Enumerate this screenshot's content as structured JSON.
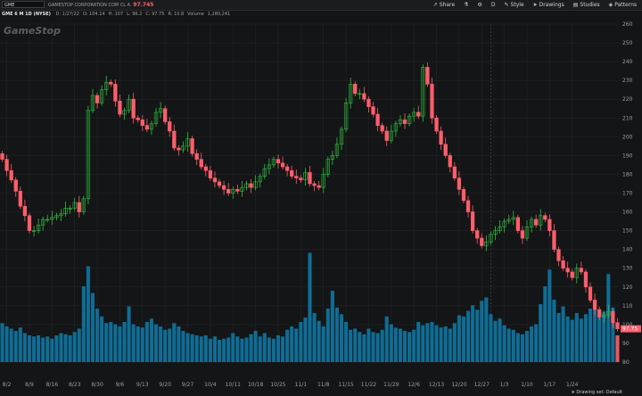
{
  "toolbar": {
    "symbol": "GME",
    "quote_text": "GAMESTOP CORPORATION COM CL A",
    "last_price": "97.745",
    "buttons": [
      {
        "label": "Share",
        "icon": "share-icon",
        "glyph": "↗"
      },
      {
        "label": "",
        "icon": "flask-icon",
        "glyph": "⚗"
      },
      {
        "label": "",
        "icon": "gear-icon",
        "glyph": "⚙"
      },
      {
        "label": "D",
        "icon": "",
        "glyph": ""
      },
      {
        "label": "Style",
        "icon": "style-icon",
        "glyph": "✎"
      },
      {
        "label": "Drawings",
        "icon": "cursor-icon",
        "glyph": "➤"
      },
      {
        "label": "Studies",
        "icon": "studies-icon",
        "glyph": "▤"
      },
      {
        "label": "Patterns",
        "icon": "patterns-icon",
        "glyph": "◈"
      }
    ]
  },
  "infobar": {
    "symbol_label": "GME 6 M 1D (NYSE)",
    "items": [
      "D: 1/27/22",
      "O: 104.14",
      "H: 107",
      "L: 96.2",
      "C: 97.75",
      "R: 10.8",
      "Volume",
      "1,280,241"
    ]
  },
  "watermark": "GameStop",
  "status_text": "Drawing set: Default",
  "colors": {
    "up": "#2fbf3f",
    "down": "#ff5e6c",
    "volume": "#0f6d95",
    "volume_last": "#ff5e6c",
    "bg": "#141516",
    "grid": "#232528"
  },
  "chart_data": {
    "type": "candlestick",
    "y_axis": {
      "min": 80,
      "max": 260,
      "step": 10,
      "position": "right"
    },
    "y_ticks": [
      "260",
      "250",
      "240",
      "230",
      "220",
      "210",
      "200",
      "190",
      "180",
      "170",
      "160",
      "150",
      "140",
      "130",
      "120",
      "110",
      "100",
      "90",
      "80"
    ],
    "last_price_label": "97.75",
    "x_labels": [
      "8/2",
      "8/9",
      "8/16",
      "8/23",
      "8/30",
      "9/6",
      "9/13",
      "9/20",
      "9/27",
      "10/4",
      "10/11",
      "10/18",
      "10/25",
      "11/1",
      "11/8",
      "11/15",
      "11/22",
      "11/29",
      "12/6",
      "12/13",
      "12/20",
      "12/27",
      "1/3",
      "1/10",
      "1/17",
      "1/24"
    ],
    "x_label_index": [
      1,
      6,
      11,
      16,
      21,
      26,
      31,
      36,
      41,
      46,
      51,
      56,
      61,
      66,
      71,
      76,
      81,
      86,
      91,
      96,
      101,
      106,
      111,
      116,
      121,
      126
    ],
    "closes": [
      188,
      182,
      177,
      171,
      163,
      158,
      150,
      150,
      153,
      156,
      156,
      157,
      158,
      159,
      162,
      162,
      165,
      160,
      167,
      214,
      222,
      218,
      225,
      229,
      228,
      219,
      212,
      214,
      220,
      210,
      209,
      206,
      204,
      207,
      213,
      215,
      208,
      203,
      194,
      193,
      195,
      199,
      191,
      188,
      184,
      182,
      178,
      176,
      174,
      172,
      170,
      172,
      171,
      173,
      175,
      173,
      176,
      179,
      183,
      185,
      188,
      186,
      184,
      182,
      179,
      178,
      177,
      181,
      175,
      174,
      173,
      180,
      188,
      190,
      196,
      204,
      218,
      228,
      223,
      223,
      220,
      216,
      212,
      206,
      203,
      198,
      203,
      207,
      209,
      207,
      211,
      213,
      211,
      237,
      228,
      210,
      203,
      196,
      190,
      184,
      178,
      172,
      166,
      160,
      150,
      146,
      142,
      144,
      148,
      150,
      152,
      155,
      156,
      157,
      150,
      146,
      152,
      156,
      153,
      158,
      156,
      150,
      140,
      134,
      130,
      128,
      125,
      130,
      128,
      120,
      113,
      108,
      104,
      105,
      107,
      101,
      97.75
    ],
    "volumes": [
      3.5,
      3.2,
      3.0,
      2.8,
      3.1,
      2.6,
      2.4,
      2.3,
      2.4,
      2.2,
      2.3,
      2.1,
      2.4,
      2.6,
      2.5,
      2.4,
      2.7,
      3.0,
      6.8,
      8.6,
      6.2,
      4.8,
      4.1,
      3.5,
      3.6,
      3.4,
      3.2,
      3.6,
      5.0,
      3.4,
      3.2,
      3.1,
      3.6,
      3.9,
      3.4,
      3.2,
      2.9,
      3.0,
      3.5,
      3.2,
      2.8,
      2.6,
      2.5,
      2.4,
      2.3,
      2.4,
      2.1,
      2.3,
      2.0,
      2.1,
      2.2,
      2.6,
      2.3,
      2.1,
      2.2,
      2.5,
      2.8,
      2.3,
      2.6,
      2.2,
      2.1,
      2.4,
      2.3,
      2.9,
      3.2,
      3.0,
      3.6,
      4.0,
      9.8,
      4.4,
      3.7,
      3.2,
      4.8,
      6.4,
      4.9,
      4.3,
      3.6,
      2.9,
      3.0,
      2.7,
      2.5,
      3.0,
      2.7,
      2.6,
      2.9,
      4.1,
      3.4,
      3.1,
      3.0,
      2.8,
      2.7,
      2.9,
      3.6,
      3.3,
      3.5,
      3.6,
      3.3,
      3.1,
      3.2,
      3.0,
      3.5,
      4.2,
      4.1,
      4.6,
      5.1,
      4.7,
      5.5,
      5.8,
      4.3,
      3.7,
      3.9,
      3.3,
      3.0,
      2.9,
      2.6,
      2.5,
      2.8,
      3.2,
      3.4,
      5.2,
      6.8,
      8.3,
      5.6,
      4.4,
      5.0,
      4.1,
      3.8,
      4.4,
      3.9,
      4.3,
      4.8,
      5.6,
      4.6,
      4.5,
      7.9,
      4.9,
      2.4
    ],
    "volume_axis": {
      "min": 0,
      "max": 12
    }
  }
}
